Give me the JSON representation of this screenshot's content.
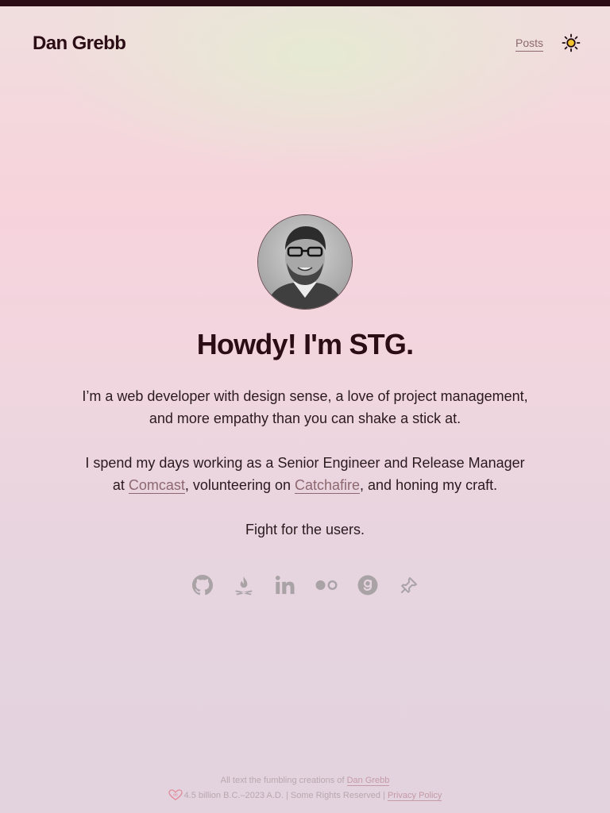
{
  "header": {
    "site_title": "Dan Grebb",
    "nav_posts": "Posts",
    "theme_toggle_icon": "sun-icon"
  },
  "hero": {
    "avatar_icon": "avatar-photo",
    "title": "Howdy! I'm STG.",
    "intro_line1": "I’m a web developer with design sense, a love of project management,",
    "intro_line2": "and more empathy than you can shake a stick at.",
    "work_line1": "I spend my days working as a Senior Engineer and Release Manager",
    "work_at": "at ",
    "work_link1": "Comcast",
    "work_mid": ", volunteering on ",
    "work_link2": "Catchafire",
    "work_end": ", and honing my craft.",
    "motto": "Fight for the users."
  },
  "socials": [
    {
      "icon": "github-icon"
    },
    {
      "icon": "campfire-icon"
    },
    {
      "icon": "linkedin-icon"
    },
    {
      "icon": "flickr-icon"
    },
    {
      "icon": "goodreads-icon"
    },
    {
      "icon": "pinboard-icon"
    }
  ],
  "footer": {
    "line1_text": "All text the fumbling creations of ",
    "line1_link": "Dan Grebb",
    "line2_text": "4.5 billion B.C.–2023 A.D. | Some Rights Reserved | ",
    "line2_link": "Privacy Policy",
    "cc_icon": "creative-commons-heart-icon"
  },
  "colors": {
    "accent": "#8d6870",
    "heading": "#2b0d15",
    "topbar": "#2b0d15",
    "sun": "#f4c430",
    "social_icons": "#a9a3a6"
  }
}
